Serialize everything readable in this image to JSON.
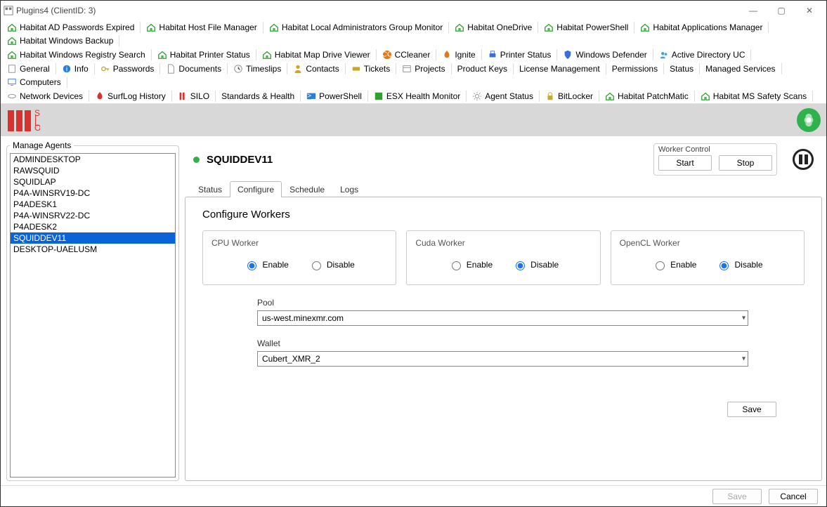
{
  "window": {
    "title": "Plugins4  (ClientID: 3)",
    "min": "—",
    "max": "▢",
    "close": "✕"
  },
  "toolbar": {
    "row1": [
      {
        "icon": "house",
        "color": "#2fa12f",
        "label": "Habitat AD Passwords Expired"
      },
      {
        "icon": "house",
        "color": "#2fa12f",
        "label": "Habitat Host File Manager"
      },
      {
        "icon": "house",
        "color": "#2fa12f",
        "label": "Habitat Local Administrators Group Monitor"
      },
      {
        "icon": "house",
        "color": "#2fa12f",
        "label": "Habitat OneDrive"
      },
      {
        "icon": "house",
        "color": "#2fa12f",
        "label": "Habitat PowerShell"
      },
      {
        "icon": "house",
        "color": "#2fa12f",
        "label": "Habitat Applications Manager"
      },
      {
        "icon": "house",
        "color": "#2fa12f",
        "label": "Habitat Windows Backup"
      }
    ],
    "row2": [
      {
        "icon": "house",
        "color": "#2fa12f",
        "label": "Habitat Windows Registry Search"
      },
      {
        "icon": "house",
        "color": "#2fa12f",
        "label": "Habitat Printer Status"
      },
      {
        "icon": "house",
        "color": "#2fa12f",
        "label": "Habitat Map Drive Viewer"
      },
      {
        "icon": "cc",
        "color": "#e07b1a",
        "label": "CCleaner"
      },
      {
        "icon": "flame",
        "color": "#e07b1a",
        "label": "Ignite"
      },
      {
        "icon": "printer",
        "color": "#3a6fd8",
        "label": "Printer Status"
      },
      {
        "icon": "shield",
        "color": "#3a6fd8",
        "label": "Windows Defender"
      },
      {
        "icon": "users",
        "color": "#3aa0d8",
        "label": "Active Directory UC"
      }
    ],
    "row3": [
      {
        "icon": "page",
        "color": "#888",
        "label": "General"
      },
      {
        "icon": "info",
        "color": "#2a7fd4",
        "label": "Info"
      },
      {
        "icon": "key",
        "color": "#caa726",
        "label": "Passwords"
      },
      {
        "icon": "doc",
        "color": "#888",
        "label": "Documents"
      },
      {
        "icon": "clock",
        "color": "#888",
        "label": "Timeslips"
      },
      {
        "icon": "user",
        "color": "#caa726",
        "label": "Contacts"
      },
      {
        "icon": "ticket",
        "color": "#caa726",
        "label": "Tickets"
      },
      {
        "icon": "proj",
        "color": "#888",
        "label": "Projects"
      },
      {
        "icon": "none",
        "label": "Product Keys"
      },
      {
        "icon": "none",
        "label": "License Management"
      },
      {
        "icon": "none",
        "label": "Permissions"
      },
      {
        "icon": "none",
        "label": "Status"
      },
      {
        "icon": "none",
        "label": "Managed Services"
      },
      {
        "icon": "pc",
        "color": "#3a6fd8",
        "label": "Computers"
      }
    ],
    "row4": [
      {
        "icon": "net",
        "color": "#888",
        "label": "Network Devices"
      },
      {
        "icon": "flame",
        "color": "#d9322e",
        "label": "SurfLog History"
      },
      {
        "icon": "silo",
        "color": "#d9322e",
        "label": "SILO"
      },
      {
        "icon": "none",
        "label": "Standards & Health"
      },
      {
        "icon": "ps",
        "color": "#2a7fd4",
        "label": "PowerShell"
      },
      {
        "icon": "esx",
        "color": "#2fa12f",
        "label": "ESX Health Monitor"
      },
      {
        "icon": "cog",
        "color": "#888",
        "label": "Agent Status"
      },
      {
        "icon": "lock",
        "color": "#caa726",
        "label": "BitLocker"
      },
      {
        "icon": "house",
        "color": "#2fa12f",
        "label": "Habitat PatchMatic"
      },
      {
        "icon": "house",
        "color": "#2fa12f",
        "label": "Habitat MS Safety Scans"
      }
    ]
  },
  "left": {
    "legend": "Manage Agents",
    "agents": [
      "ADMINDESKTOP",
      "RAWSQUID",
      "SQUIDLAP",
      "P4A-WINSRV19-DC",
      "P4ADESK1",
      "P4A-WINSRV22-DC",
      "P4ADESK2",
      "SQUIDDEV11",
      "DESKTOP-UAELUSM"
    ],
    "selected": "SQUIDDEV11"
  },
  "header": {
    "agent": "SQUIDDEV11",
    "workerControl": "Worker Control",
    "start": "Start",
    "stop": "Stop"
  },
  "tabs": [
    "Status",
    "Configure",
    "Schedule",
    "Logs"
  ],
  "activeTab": "Configure",
  "configure": {
    "title": "Configure Workers",
    "workers": [
      {
        "name": "CPU Worker",
        "enable": "Enable",
        "disable": "Disable",
        "value": "enable"
      },
      {
        "name": "Cuda  Worker",
        "enable": "Enable",
        "disable": "Disable",
        "value": "disable"
      },
      {
        "name": "OpenCL Worker",
        "enable": "Enable",
        "disable": "Disable",
        "value": "disable"
      }
    ],
    "poolLabel": "Pool",
    "poolValue": "us-west.minexmr.com",
    "walletLabel": "Wallet",
    "walletValue": "Cubert_XMR_2",
    "saveBtn": "Save"
  },
  "footer": {
    "save": "Save",
    "cancel": "Cancel"
  }
}
